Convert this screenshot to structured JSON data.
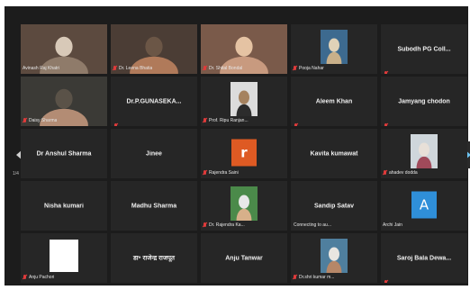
{
  "navigation": {
    "page_indicator": "1/4"
  },
  "participants": [
    {
      "name": "Avinash Raj Khatri",
      "kind": "video",
      "muted": false,
      "active": true,
      "palette": [
        "#5c4a3f",
        "#8f7b6a",
        "#d8c9b8"
      ]
    },
    {
      "name": "Dr. Leena Bhatia",
      "kind": "video",
      "muted": true,
      "palette": [
        "#4b3d35",
        "#b07a5a",
        "#6b5646"
      ]
    },
    {
      "name": "Dr. Shital Bondal",
      "kind": "video",
      "muted": true,
      "palette": [
        "#7a5a4a",
        "#c89a7f",
        "#e5c3a3"
      ]
    },
    {
      "name": "Pooja Nahar",
      "kind": "photo",
      "muted": true,
      "palette": [
        "#3d6a8f",
        "#c9b08a",
        "#e0d2b8"
      ]
    },
    {
      "name": "Subodh PG Coll...",
      "kind": "name",
      "muted": true
    },
    {
      "name": "Daisy Sharma",
      "kind": "video",
      "muted": true,
      "palette": [
        "#3b3a36",
        "#b38c74",
        "#5a5248"
      ]
    },
    {
      "name": "Dr.P.GUNASEKA...",
      "kind": "name",
      "muted": true
    },
    {
      "name": "Prof. Ripu Ranjan...",
      "kind": "photo",
      "muted": true,
      "palette": [
        "#dcdcdc",
        "#2c2c2c",
        "#a5825f"
      ]
    },
    {
      "name": "Aleem Khan",
      "kind": "name",
      "muted": true
    },
    {
      "name": "Jamyang chodon",
      "kind": "name",
      "muted": true
    },
    {
      "name": "Dr Anshul Sharma",
      "kind": "name",
      "muted": false
    },
    {
      "name": "Jinee",
      "kind": "name",
      "muted": false
    },
    {
      "name": "Rajendra Saini",
      "kind": "avatar",
      "initial": "r",
      "color": "#de5a23",
      "muted": true
    },
    {
      "name": "Kavita kumawat",
      "kind": "name",
      "muted": false
    },
    {
      "name": "ahadev dodda",
      "kind": "photo",
      "muted": true,
      "palette": [
        "#cfd6db",
        "#a04a5a",
        "#e8e0d8"
      ]
    },
    {
      "name": "Nisha kumari",
      "kind": "name",
      "muted": false
    },
    {
      "name": "Madhu Sharma",
      "kind": "name",
      "muted": false
    },
    {
      "name": "Dr. Rajendra Ka...",
      "kind": "photo",
      "muted": true,
      "palette": [
        "#4b8a4a",
        "#d7b08a",
        "#e8e8e8"
      ]
    },
    {
      "name": "Sandip Satav",
      "kind": "name",
      "muted": false,
      "status": "Connecting to au..."
    },
    {
      "name": "Archi Jain",
      "kind": "avatar",
      "initial": "A",
      "color": "#2f8fd9",
      "muted": false
    },
    {
      "name": "Anju Pachori",
      "kind": "white",
      "muted": true
    },
    {
      "name": "डा॰ राजेन्द्र राजपूत",
      "kind": "name",
      "muted": false
    },
    {
      "name": "Anju Tanwar",
      "kind": "name",
      "muted": false
    },
    {
      "name": "Dr.shri kumar m...",
      "kind": "photo",
      "muted": true,
      "palette": [
        "#4f7f9e",
        "#b68768",
        "#e9e6e1"
      ]
    },
    {
      "name": "Saroj Bala Dewa...",
      "kind": "name",
      "muted": true
    }
  ]
}
